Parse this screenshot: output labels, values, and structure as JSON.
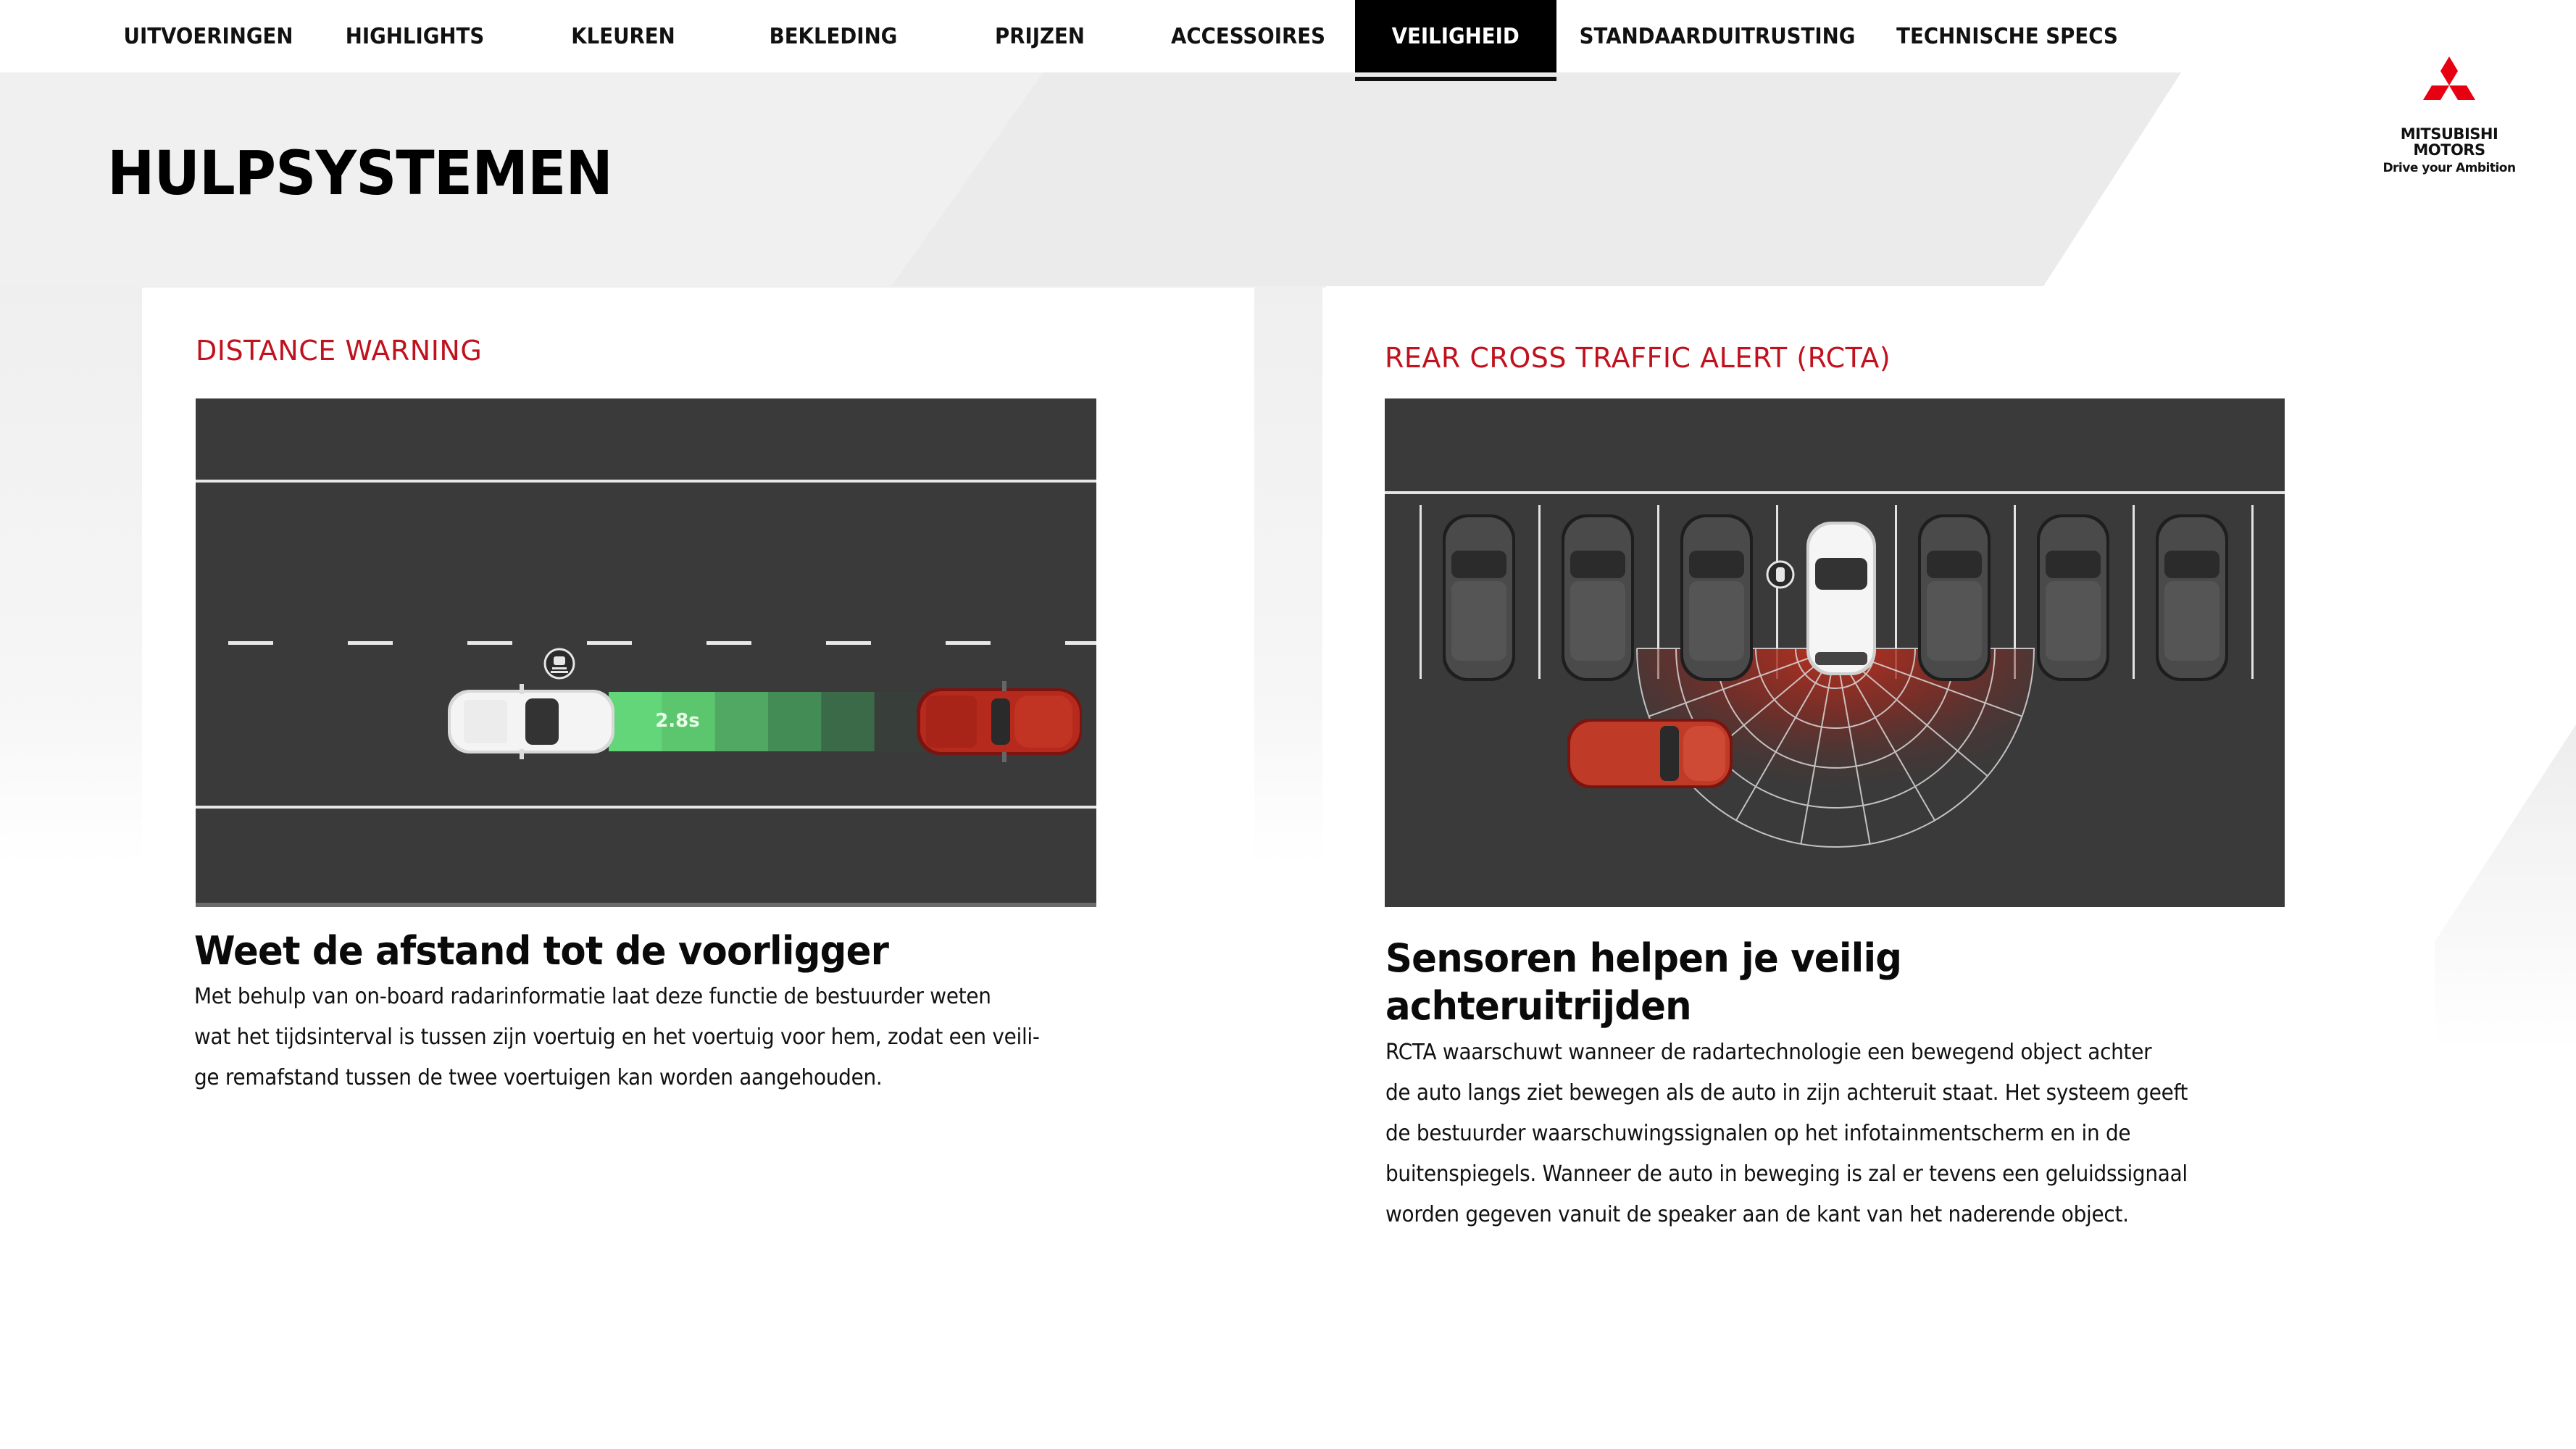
{
  "nav": {
    "items": [
      {
        "label": "UITVOERINGEN",
        "active": false
      },
      {
        "label": "HIGHLIGHTS",
        "active": false
      },
      {
        "label": "KLEUREN",
        "active": false
      },
      {
        "label": "BEKLEDING",
        "active": false
      },
      {
        "label": "PRIJZEN",
        "active": false
      },
      {
        "label": "ACCESSOIRES",
        "active": false
      },
      {
        "label": "VEILIGHEID",
        "active": true
      },
      {
        "label": "STANDAARDUITRUSTING",
        "active": false
      },
      {
        "label": "TECHNISCHE SPECS",
        "active": false
      }
    ]
  },
  "brand": {
    "name_line1": "MITSUBISHI",
    "name_line2": "MOTORS",
    "tagline": "Drive your Ambition",
    "logo_icon": "three-diamonds-icon",
    "color": "#e60012"
  },
  "page": {
    "title": "HULPSYSTEMEN"
  },
  "features": [
    {
      "label": "DISTANCE WARNING",
      "heading": "Weet de afstand tot de voorligger",
      "body_lines": [
        "Met behulp van on-board radarinformatie laat deze functie de bestuurder weten",
        "wat het tijdsinterval is tussen zijn voertuig en het voertuig voor hem, zodat een veili-",
        "ge remafstand tussen de twee voertuigen kan worden aangehouden."
      ],
      "illustration": {
        "type": "distance-warning-diagram",
        "time_gap": "2.8s",
        "indicator_icon": "distance-warning-icon",
        "gap_colors": [
          "#62d679",
          "#5cc66e",
          "#50a862",
          "#448c56",
          "#3a6a48",
          "#383f3a"
        ]
      }
    },
    {
      "label": "REAR CROSS TRAFFIC ALERT (RCTA)",
      "heading_lines": [
        "Sensoren helpen je veilig",
        "achteruitrijden"
      ],
      "body_lines": [
        "RCTA waarschuwt wanneer de radartechnologie een bewegend object achter",
        "de auto langs ziet bewegen als de auto in zijn achteruit staat. Het systeem geeft",
        "de bestuurder waarschuwingssignalen op het infotainmentscherm en in de",
        "buitenspiegels. Wanneer de auto in beweging is zal er tevens een geluidssignaal",
        "worden gegeven vanuit de speaker aan de kant van het naderende object."
      ],
      "illustration": {
        "type": "rcta-diagram",
        "parked_cars": 6,
        "indicator_icon": "rcta-sensor-icon"
      }
    }
  ],
  "colors": {
    "accent_red": "#c0121e",
    "road": "#3a3a3a",
    "nav_active_bg": "#000000"
  }
}
